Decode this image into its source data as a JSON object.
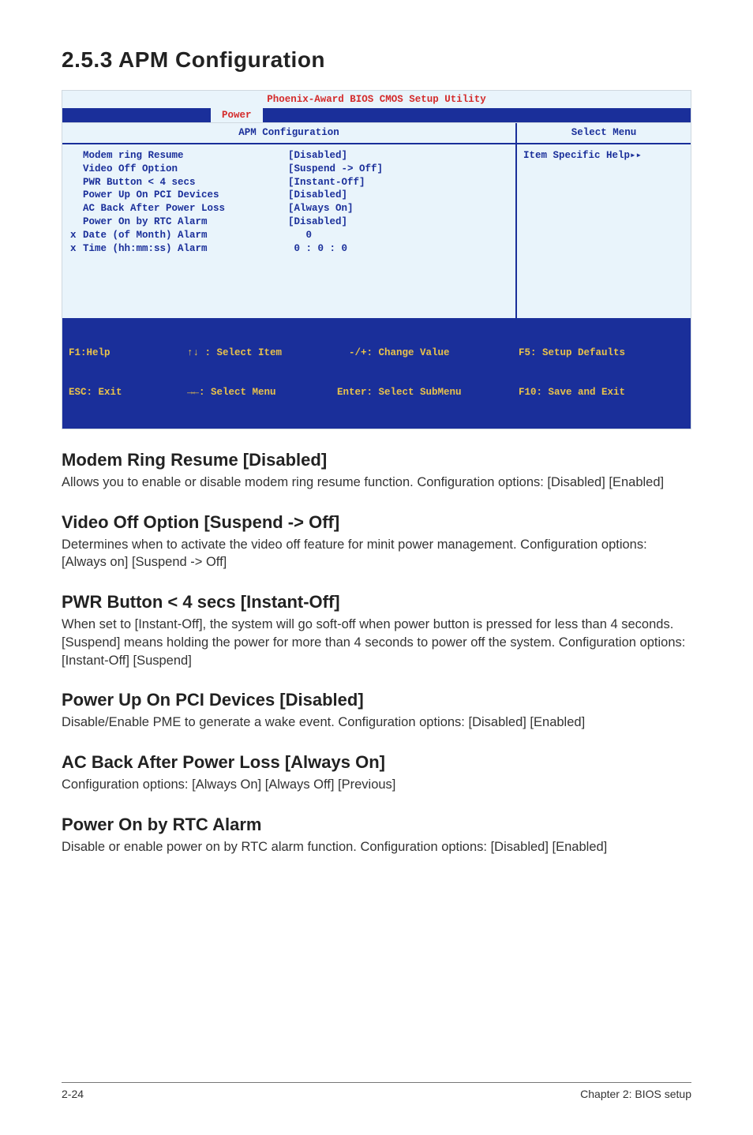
{
  "section_title": "2.5.3   APM Configuration",
  "bios": {
    "window_title": "Phoenix-Award BIOS CMOS Setup Utility",
    "active_tab": "Power",
    "left_header": "APM Configuration",
    "right_header": "Select  Menu",
    "help_text": "Item Specific Help",
    "rows": [
      {
        "mark": "",
        "label": "Modem ring Resume",
        "value": "[Disabled]"
      },
      {
        "mark": "",
        "label": "Video Off Option",
        "value": "[Suspend -> Off]"
      },
      {
        "mark": "",
        "label": "PWR Button < 4 secs",
        "value": "[Instant-Off]"
      },
      {
        "mark": "",
        "label": "Power Up On PCI Devices",
        "value": "[Disabled]"
      },
      {
        "mark": "",
        "label": "AC Back After Power Loss",
        "value": "[Always On]"
      },
      {
        "mark": "",
        "label": "Power On by RTC Alarm",
        "value": "[Disabled]"
      },
      {
        "mark": "x",
        "label": "Date (of Month) Alarm",
        "value": "   0"
      },
      {
        "mark": "x",
        "label": "Time (hh:mm:ss) Alarm",
        "value": " 0 : 0 : 0"
      }
    ],
    "footer": {
      "c1a": "F1:Help",
      "c2a": "↑↓ : Select Item",
      "c3a": "  -/+: Change Value",
      "c4a": "F5: Setup Defaults",
      "c1b": "ESC: Exit",
      "c2b": "→←: Select Menu",
      "c3b": "Enter: Select SubMenu",
      "c4b": "F10: Save and Exit"
    }
  },
  "sections": [
    {
      "title": "Modem Ring Resume [Disabled]",
      "body": "Allows you to enable or disable modem ring resume function. Configuration options: [Disabled] [Enabled]"
    },
    {
      "title": "Video Off Option [Suspend -> Off]",
      "body": "Determines when to activate the video off feature for minit power management. Configuration options: [Always on] [Suspend -> Off]"
    },
    {
      "title": "PWR Button < 4 secs [Instant-Off]",
      "body": "When set to [Instant-Off], the system will go soft-off when power button is pressed for less than 4 seconds. [Suspend] means holding the power for more than 4 seconds to power off the system. Configuration options: [Instant-Off] [Suspend]"
    },
    {
      "title": "Power Up On PCI Devices [Disabled]",
      "body": "Disable/Enable PME to generate a wake event. Configuration options: [Disabled] [Enabled]"
    },
    {
      "title": "AC Back After Power Loss [Always On]",
      "body": "Configuration options: [Always On] [Always Off] [Previous]"
    },
    {
      "title": "Power On by RTC Alarm",
      "body": "Disable or enable power on by RTC alarm function. Configuration options: [Disabled] [Enabled]"
    }
  ],
  "footer": {
    "left": "2-24",
    "right": "Chapter 2: BIOS setup"
  }
}
